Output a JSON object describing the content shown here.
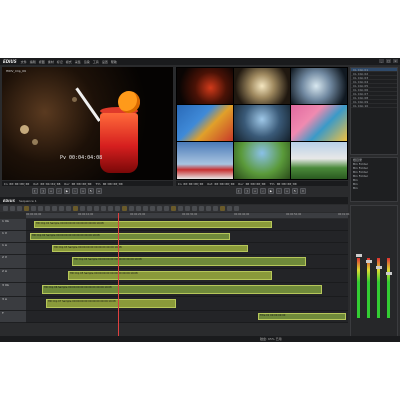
{
  "app": {
    "logo": "EDIUS",
    "menu": [
      "文件",
      "编辑",
      "视图",
      "素材",
      "标记",
      "模式",
      "采集",
      "渲染",
      "工具",
      "设置",
      "帮助"
    ],
    "window_buttons": [
      "_",
      "□",
      "×"
    ]
  },
  "player": {
    "clip_name": "HIDV_Clip_09",
    "timecode": "Pv 00:04:04:08",
    "tc_in": "In 00:00:00;00",
    "tc_out": "Out 00:04:04;08",
    "tc_dur": "Dur 00:00:00;00",
    "tc_ttl": "Ttl 00:00:00;00"
  },
  "recorder": {
    "tc_in": "In 00:00:00;00",
    "tc_out": "Out 00:00:00;00",
    "tc_dur": "Dur 00:00:00;00",
    "tc_ttl": "Ttl 00:00:00;00"
  },
  "bin": {
    "rows": [
      "CL Clip 01",
      "CL Clip 02",
      "CL Clip 03",
      "CL Clip 04",
      "CL Clip 05",
      "CL Clip 06",
      "CL Clip 07",
      "CL Clip 08",
      "CL Clip 09",
      "CL Clip 10"
    ],
    "folders": [
      "根目录",
      "  Bin Folder",
      "  Bin Folder",
      "  Bin Folder",
      "  Bin Folder",
      "  Bin",
      "  Bin",
      "  Bin"
    ]
  },
  "timeline": {
    "logo": "EDIUS",
    "sequence": "Sequence 1",
    "ruler": [
      "00:00:00;00",
      "00:00:10;00",
      "00:00:20;00",
      "00:00:30;00",
      "00:00:40;00",
      "00:00:50;00",
      "00:01:00;00"
    ],
    "tracks": [
      {
        "name": "1 VA",
        "clips": [
          {
            "label": "HD Clip 01 Sample 00:00:00:00 00:00:00 00:00:10:08"
          }
        ]
      },
      {
        "name": "1 V",
        "clips": [
          {
            "label": "HD Clip 02 Sample 00:00:00:00 00:00:00 00:00:10:08"
          }
        ]
      },
      {
        "name": "1 A",
        "clips": [
          {
            "label": "HD Clip 03 Sample 00:00:00:00 00:00:00 00:00:10:08"
          }
        ]
      },
      {
        "name": "2 V",
        "clips": [
          {
            "label": "HD Clip 04 Sample 00:00:00:00 00:00:00 00:00:10:08"
          }
        ]
      },
      {
        "name": "2 A",
        "clips": [
          {
            "label": "HD Clip 05 Sample 00:00:00:00 00:00:00 00:00:10:08"
          }
        ]
      },
      {
        "name": "3 VA",
        "clips": [
          {
            "label": "HD Clip 06 Sample 00:00:00:00 00:00:00 00:00:10:08"
          }
        ]
      },
      {
        "name": "3 A",
        "clips": [
          {
            "label": "HD Clip 07 Sample 00:00:00:00 00:00:00 00:00:10:08"
          }
        ]
      },
      {
        "name": "T",
        "clips": [
          {
            "label": "Title 01 00:00:00:00"
          }
        ]
      }
    ]
  },
  "status": "磁盘: 65% 已用",
  "colors": {
    "clip": "#8a9a3a",
    "playhead": "#e04040",
    "bg": "#2a2b2d"
  }
}
